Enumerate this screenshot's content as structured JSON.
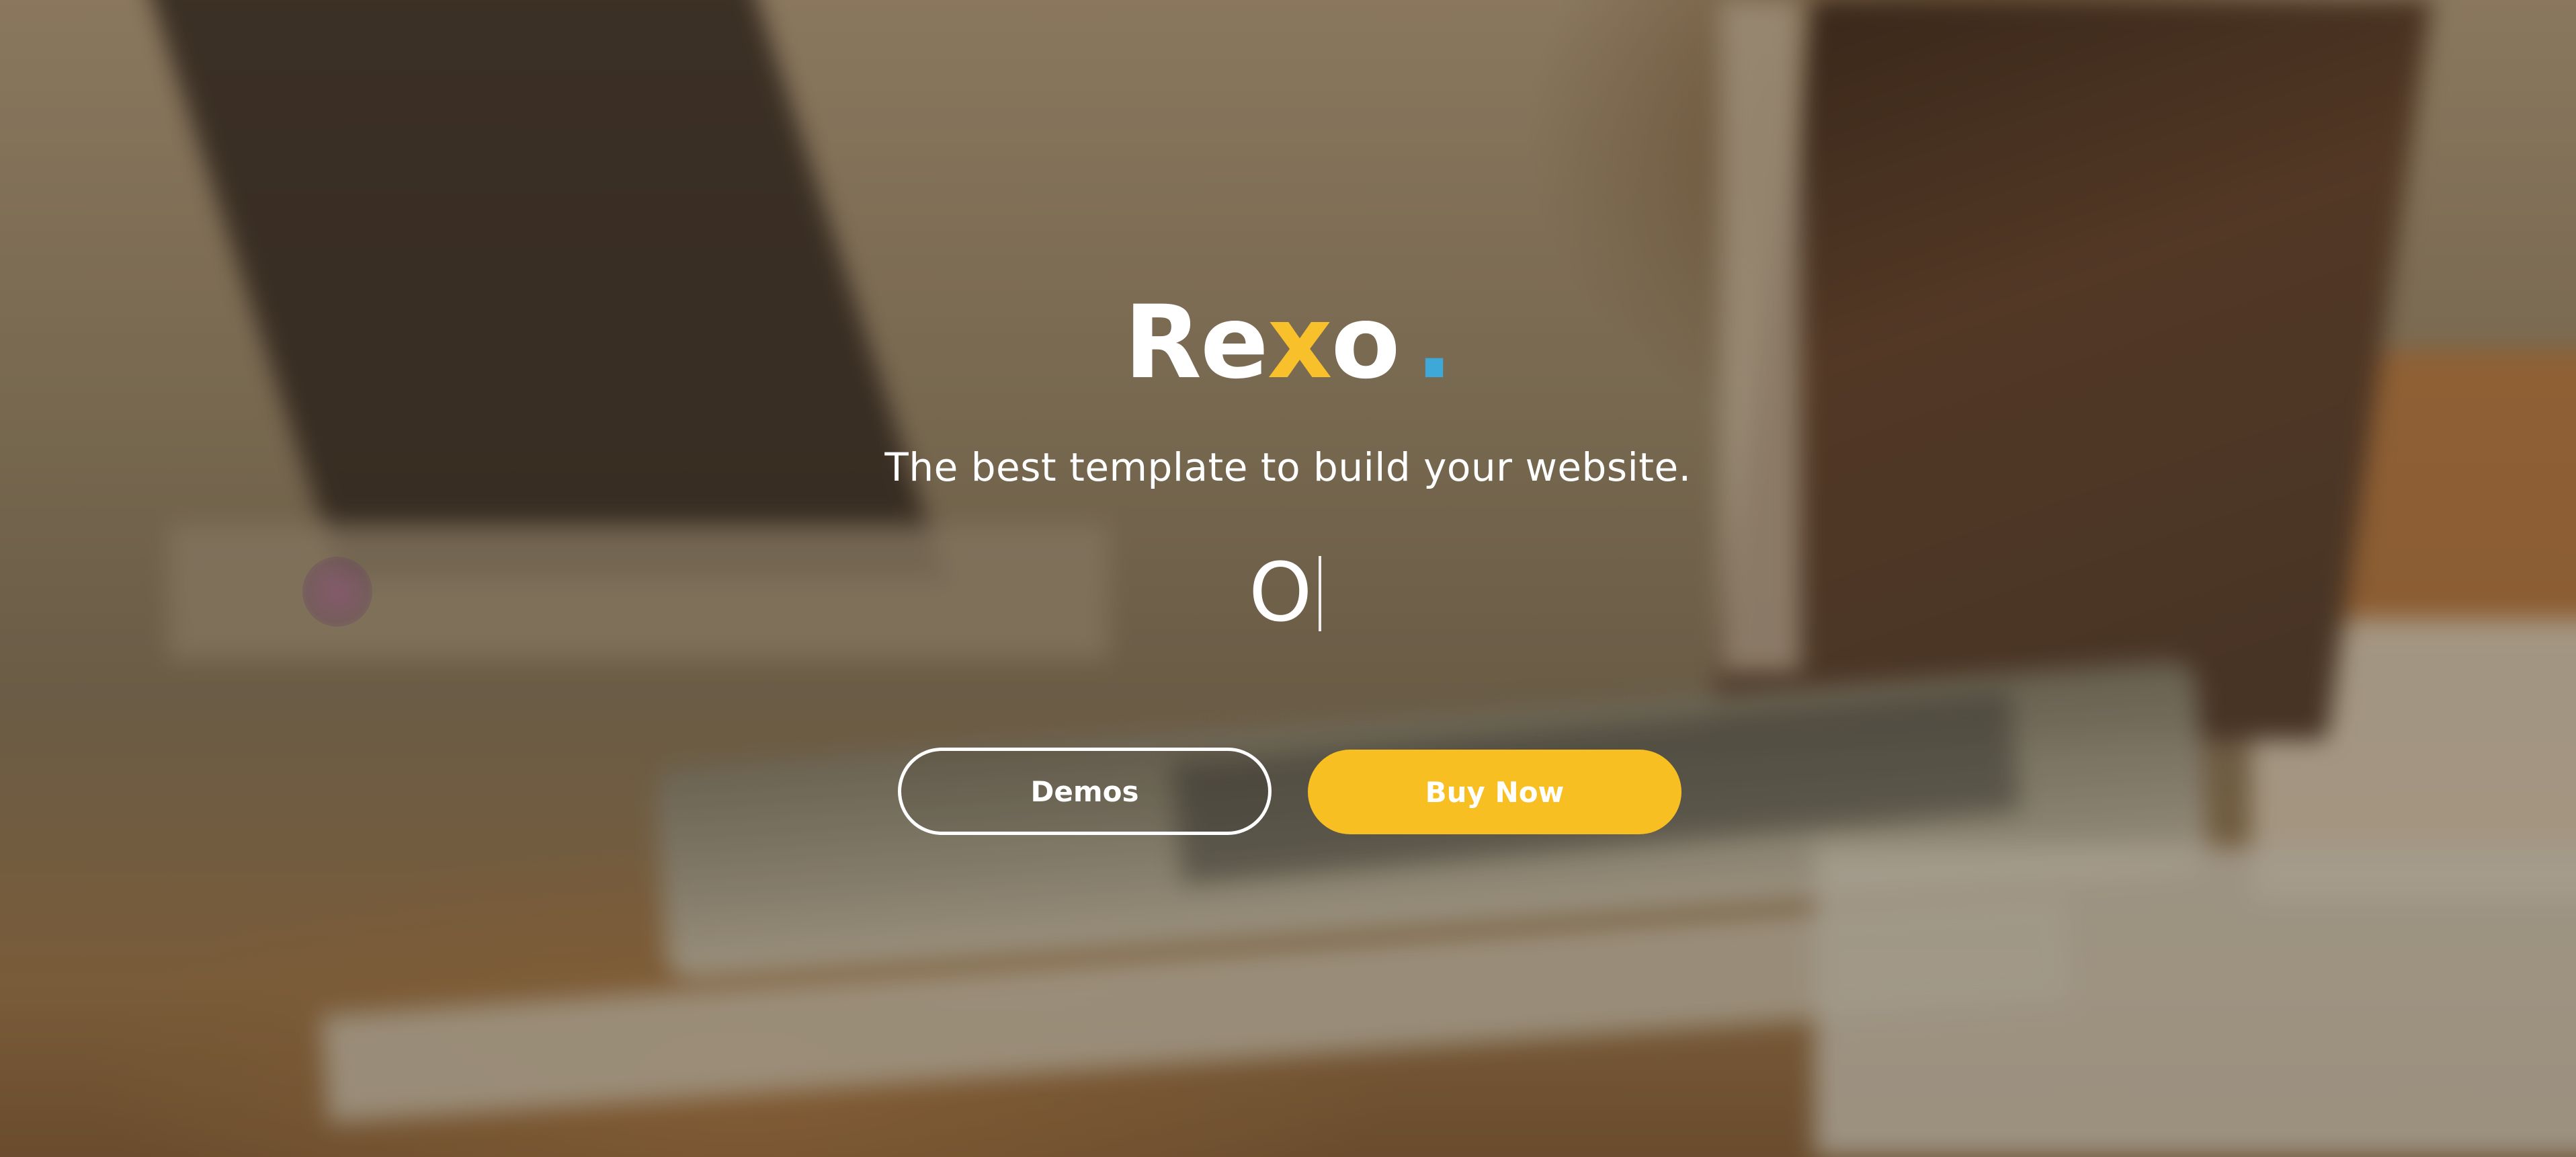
{
  "hero": {
    "logo": {
      "part1": "Re",
      "accent": "x",
      "part2": "o",
      "dot": "."
    },
    "tagline": "The best template to build your website.",
    "typing_text": "O",
    "buttons": {
      "demos_label": "Demos",
      "buy_label": "Buy Now"
    }
  },
  "colors": {
    "accent": "#f8bf22",
    "dot": "#3ea8d8",
    "text": "#ffffff"
  }
}
